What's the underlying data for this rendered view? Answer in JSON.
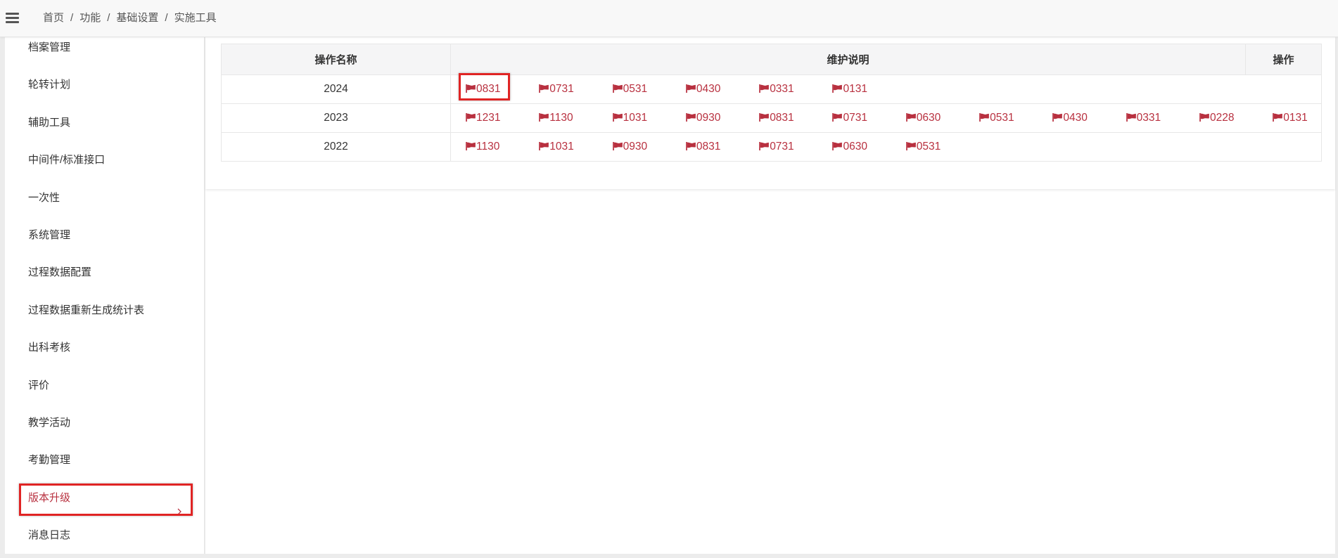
{
  "header": {
    "menu_icon": "hamburger-icon",
    "breadcrumb": [
      "首页",
      "功能",
      "基础设置",
      "实施工具"
    ],
    "separator": "/"
  },
  "sidebar": {
    "items": [
      {
        "label": "档案管理"
      },
      {
        "label": "轮转计划"
      },
      {
        "label": "辅助工具"
      },
      {
        "label": "中间件/标准接口"
      },
      {
        "label": "一次性"
      },
      {
        "label": "系统管理"
      },
      {
        "label": "过程数据配置"
      },
      {
        "label": "过程数据重新生成统计表"
      },
      {
        "label": "出科考核"
      },
      {
        "label": "评价"
      },
      {
        "label": "教学活动"
      },
      {
        "label": "考勤管理"
      },
      {
        "label": "版本升级",
        "active": true,
        "highlighted": true,
        "icon": "chevron-right-icon"
      },
      {
        "label": "消息日志"
      }
    ]
  },
  "table": {
    "headers": [
      "操作名称",
      "维护说明",
      "操作"
    ],
    "link_icon": "flag-icon",
    "rows": [
      {
        "name": "2024",
        "links": [
          {
            "label": "0831",
            "highlighted": true
          },
          {
            "label": "0731"
          },
          {
            "label": "0531"
          },
          {
            "label": "0430"
          },
          {
            "label": "0331"
          },
          {
            "label": "0131"
          }
        ]
      },
      {
        "name": "2023",
        "links": [
          {
            "label": "1231"
          },
          {
            "label": "1130"
          },
          {
            "label": "1031"
          },
          {
            "label": "0930"
          },
          {
            "label": "0831"
          },
          {
            "label": "0731"
          },
          {
            "label": "0630"
          },
          {
            "label": "0531"
          },
          {
            "label": "0430"
          },
          {
            "label": "0331"
          },
          {
            "label": "0228"
          },
          {
            "label": "0131"
          }
        ]
      },
      {
        "name": "2022",
        "links": [
          {
            "label": "1130"
          },
          {
            "label": "1031"
          },
          {
            "label": "0930"
          },
          {
            "label": "0831"
          },
          {
            "label": "0731"
          },
          {
            "label": "0630"
          },
          {
            "label": "0531"
          }
        ]
      }
    ]
  },
  "colors": {
    "accent": "#b8303f",
    "highlight_box": "#e02424",
    "text": "#333333",
    "header_bg": "#f8f8f8",
    "table_header_bg": "#f5f5f6",
    "border": "#e7e7e7"
  }
}
